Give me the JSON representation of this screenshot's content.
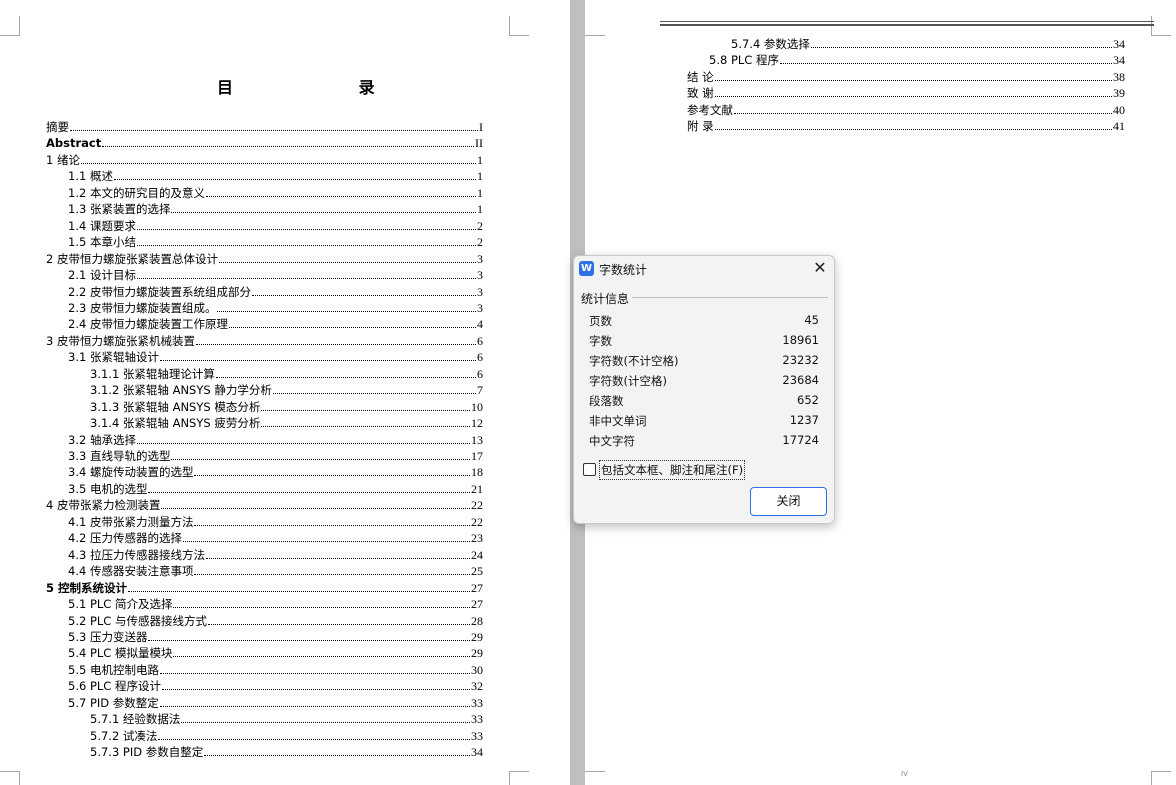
{
  "left_page": {
    "title": "目     录",
    "entries": [
      {
        "label": "摘要",
        "page": "I"
      },
      {
        "label": "Abstract",
        "page": "II"
      },
      {
        "label": "1 绪论",
        "page": "1"
      },
      {
        "label": "1.1 概述",
        "page": "1"
      },
      {
        "label": "1.2 本文的研究目的及意义",
        "page": "1"
      },
      {
        "label": "1.3 张紧装置的选择",
        "page": "1"
      },
      {
        "label": "1.4 课题要求",
        "page": "2"
      },
      {
        "label": "1.5 本章小结",
        "page": "2"
      },
      {
        "label": "2 皮带恒力螺旋张紧装置总体设计",
        "page": "3"
      },
      {
        "label": "2.1 设计目标",
        "page": "3"
      },
      {
        "label": "2.2 皮带恒力螺旋装置系统组成部分",
        "page": "3"
      },
      {
        "label": "2.3 皮带恒力螺旋装置组成。",
        "page": "3"
      },
      {
        "label": "2.4 皮带恒力螺旋装置工作原理",
        "page": "4"
      },
      {
        "label": "3 皮带恒力螺旋张紧机械装置",
        "page": "6"
      },
      {
        "label": "3.1  张紧辊轴设计",
        "page": "6"
      },
      {
        "label": "3.1.1 张紧辊轴理论计算",
        "page": "6"
      },
      {
        "label": "3.1.2 张紧辊轴 ANSYS 静力学分析",
        "page": "7"
      },
      {
        "label": "3.1.3 张紧辊轴 ANSYS 模态分析",
        "page": "10"
      },
      {
        "label": "3.1.4 张紧辊轴 ANSYS 疲劳分析",
        "page": "12"
      },
      {
        "label": "3.2 轴承选择",
        "page": "13"
      },
      {
        "label": "3.3 直线导轨的选型",
        "page": "17"
      },
      {
        "label": "3.4  螺旋传动装置的选型",
        "page": "18"
      },
      {
        "label": "3.5 电机的选型",
        "page": "21"
      },
      {
        "label": "4 皮带张紧力检测装置",
        "page": "22"
      },
      {
        "label": "4.1 皮带张紧力测量方法",
        "page": "22"
      },
      {
        "label": "4.2 压力传感器的选择",
        "page": "23"
      },
      {
        "label": "4.3 拉压力传感器接线方法",
        "page": "24"
      },
      {
        "label": "4.4 传感器安装注意事项",
        "page": "25"
      },
      {
        "label": "5 控制系统设计",
        "page": "27"
      },
      {
        "label": "5.1 PLC 简介及选择",
        "page": "27"
      },
      {
        "label": "5.2 PLC 与传感器接线方式",
        "page": "28"
      },
      {
        "label": "5.3 压力变送器",
        "page": "29"
      },
      {
        "label": "5.4 PLC 模拟量模块",
        "page": "29"
      },
      {
        "label": "5.5 电机控制电路",
        "page": "30"
      },
      {
        "label": "5.6 PLC 程序设计",
        "page": "32"
      },
      {
        "label": "5.7 PID 参数整定",
        "page": "33"
      },
      {
        "label": "5.7.1  经验数据法",
        "page": "33"
      },
      {
        "label": "5.7.2 试凑法",
        "page": "33"
      },
      {
        "label": "5.7.3 PID 参数自整定",
        "page": "34"
      }
    ]
  },
  "right_page": {
    "entries": [
      {
        "label": "5.7.4  参数选择",
        "page": "34"
      },
      {
        "label": "5.8 PLC 程序",
        "page": "34"
      },
      {
        "label": "结  论",
        "page": "38"
      },
      {
        "label": "致  谢",
        "page": "39"
      },
      {
        "label": "参考文献",
        "page": "40"
      },
      {
        "label": "附    录",
        "page": "41"
      }
    ],
    "footer_page_number": "IV"
  },
  "dialog": {
    "icon_name": "wps-writer-icon",
    "icon_glyph": "W",
    "title": "字数统计",
    "close_glyph": "✕",
    "section_label": "统计信息",
    "stats": [
      {
        "label": "页数",
        "value": "45"
      },
      {
        "label": "字数",
        "value": "18961"
      },
      {
        "label": "字符数(不计空格)",
        "value": "23232"
      },
      {
        "label": "字符数(计空格)",
        "value": "23684"
      },
      {
        "label": "段落数",
        "value": "652"
      },
      {
        "label": "非中文单词",
        "value": "1237"
      },
      {
        "label": "中文字符",
        "value": "17724"
      }
    ],
    "checkbox_label": "包括文本框、脚注和尾注(F)",
    "checkbox_checked": false,
    "close_button_label": "关闭",
    "accent_color": "#2f6fe8"
  }
}
